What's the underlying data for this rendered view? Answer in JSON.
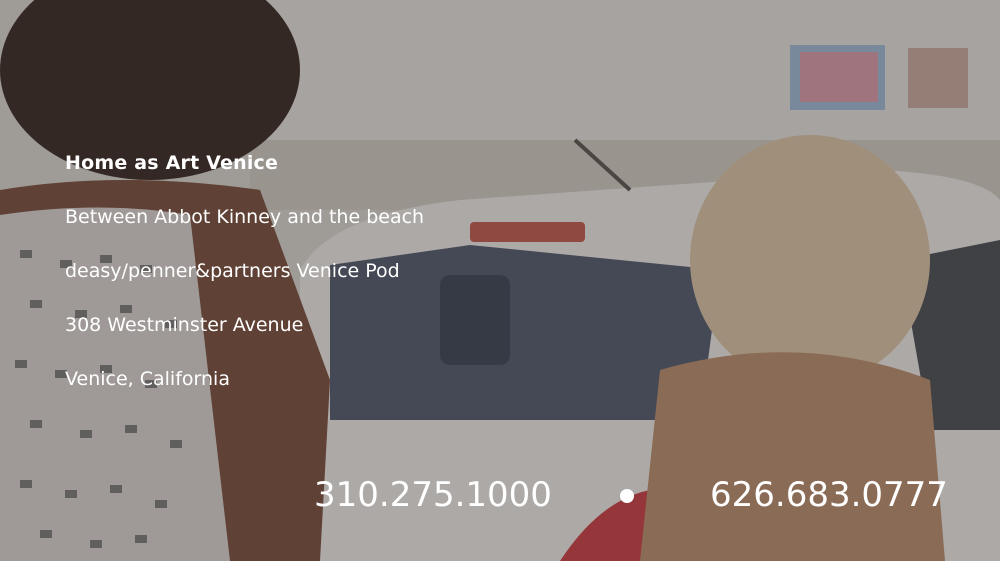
{
  "venue": {
    "title": "Home as Art Venice",
    "lines": [
      "Between Abbot Kinney and the beach",
      "deasy/penner&partners Venice Pod",
      "308 Westminster Avenue",
      "Venice, California"
    ]
  },
  "contact": {
    "phone_1": "310.275.1000",
    "phone_2": "626.683.0777"
  },
  "colors": {
    "text": "#ffffff",
    "overlay": "#28242852"
  }
}
